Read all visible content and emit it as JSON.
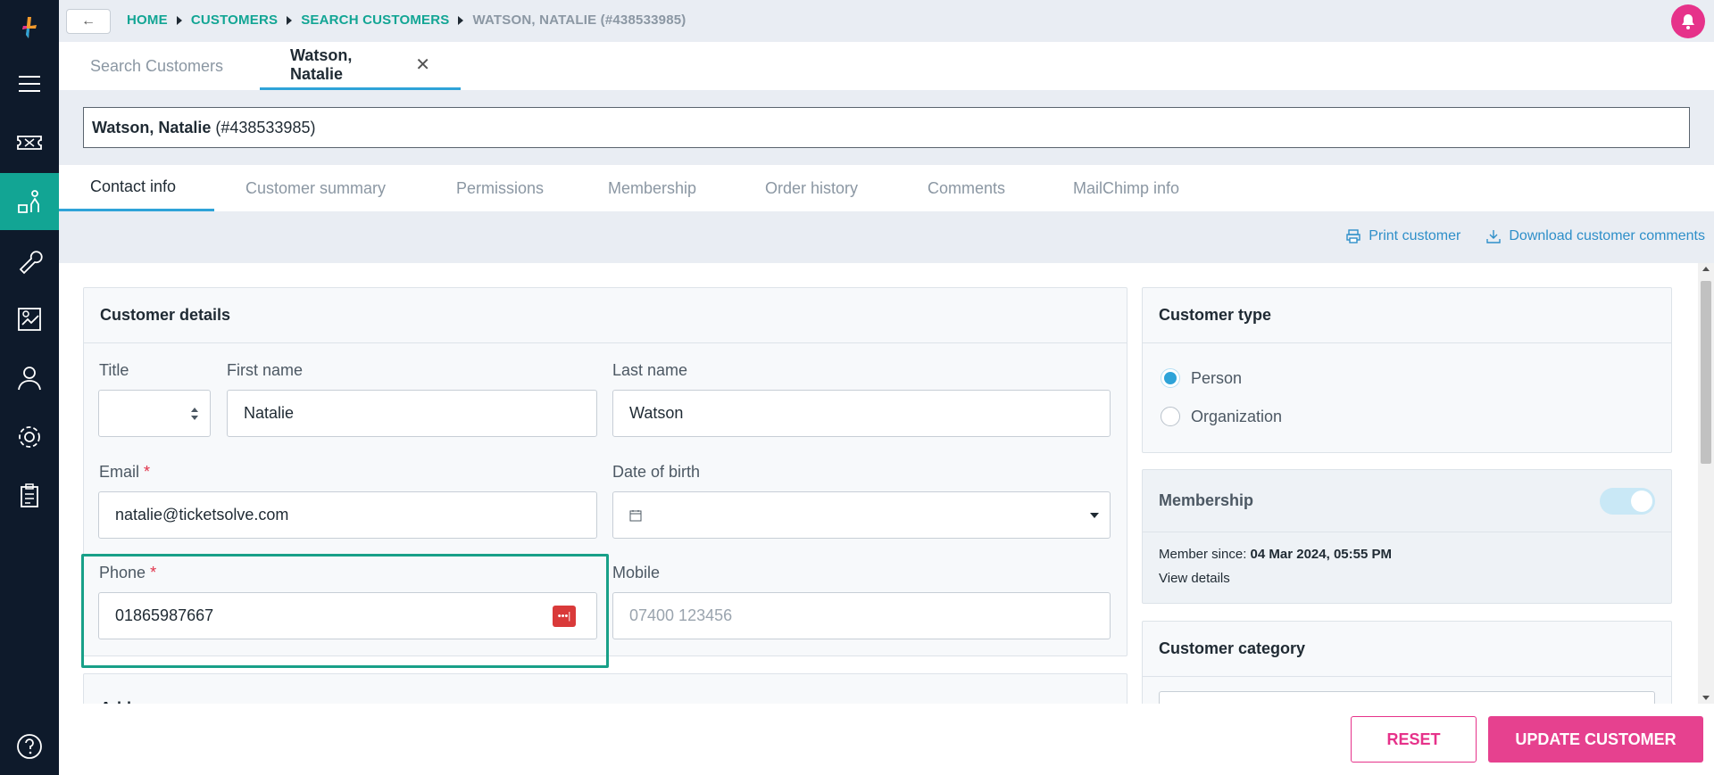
{
  "colors": {
    "accent_teal": "#12a594",
    "accent_pink": "#e6328a",
    "tab_blue": "#2ea3d8",
    "sidebar_bg": "#0e1a2b"
  },
  "breadcrumb": [
    "HOME",
    "CUSTOMERS",
    "SEARCH CUSTOMERS",
    "WATSON, NATALIE (#438533985)"
  ],
  "doc_tabs": [
    {
      "label": "Search Customers"
    },
    {
      "label": "Watson, Natalie"
    }
  ],
  "customer_title": {
    "name": "Watson, Natalie",
    "id": "(#438533985)"
  },
  "section_tabs": [
    "Contact info",
    "Customer summary",
    "Permissions",
    "Membership",
    "Order history",
    "Comments",
    "MailChimp info"
  ],
  "actions": {
    "print": "Print customer",
    "download": "Download customer comments"
  },
  "customer_details": {
    "heading": "Customer details",
    "title_label": "Title",
    "first_name_label": "First name",
    "first_name": "Natalie",
    "last_name_label": "Last name",
    "last_name": "Watson",
    "email_label": "Email",
    "email": "natalie@ticketsolve.com",
    "dob_label": "Date of birth",
    "phone_label": "Phone",
    "phone": "01865987667",
    "mobile_label": "Mobile",
    "mobile_placeholder": "07400 123456",
    "required_mark": "*"
  },
  "address_heading": "Address",
  "customer_type": {
    "heading": "Customer type",
    "options": [
      "Person",
      "Organization"
    ],
    "selected": "Person"
  },
  "membership": {
    "heading": "Membership",
    "member_since_label": "Member since:",
    "member_since": "04 Mar 2024, 05:55 PM",
    "view_details": "View details"
  },
  "customer_category": {
    "heading": "Customer category"
  },
  "footer": {
    "reset": "RESET",
    "update": "UPDATE CUSTOMER"
  },
  "sidebar_icons": [
    "logo-icon",
    "menu-icon",
    "ticket-icon",
    "customers-icon",
    "tools-icon",
    "reports-icon",
    "user-icon",
    "settings-icon",
    "clipboard-icon",
    "help-icon"
  ]
}
